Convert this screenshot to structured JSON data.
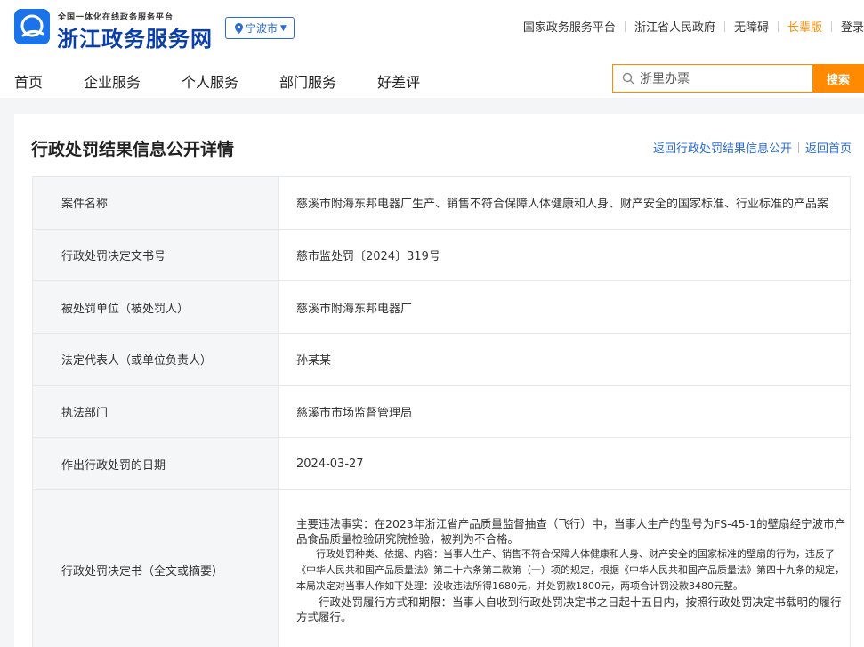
{
  "header": {
    "logo_small": "全国一体化在线政务服务平台",
    "logo_big": "浙江政务服务网",
    "city": "宁波市",
    "links": [
      "国家政务服务平台",
      "浙江省人民政府",
      "无障碍",
      "长辈版",
      "登录"
    ]
  },
  "nav": {
    "items": [
      "首页",
      "企业服务",
      "个人服务",
      "部门服务",
      "好差评"
    ],
    "search_placeholder": "浙里办票",
    "search_button": "搜索"
  },
  "page": {
    "title": "行政处罚结果信息公开详情",
    "link_back_list": "返回行政处罚结果信息公开",
    "link_home": "返回首页"
  },
  "rows": [
    {
      "label": "案件名称",
      "value": "慈溪市附海东邦电器厂生产、销售不符合保障人体健康和人身、财产安全的国家标准、行业标准的产品案"
    },
    {
      "label": "行政处罚决定文书号",
      "value": "慈市监处罚〔2024〕319号"
    },
    {
      "label": "被处罚单位（被处罚人）",
      "value": "慈溪市附海东邦电器厂"
    },
    {
      "label": "法定代表人（或单位负责人）",
      "value": "孙某某"
    },
    {
      "label": "执法部门",
      "value": "慈溪市市场监督管理局"
    },
    {
      "label": "作出行政处罚的日期",
      "value": "2024-03-27"
    }
  ],
  "decision": {
    "label": "行政处罚决定书（全文或摘要）",
    "p1": "主要违法事实：在2023年浙江省产品质量监督抽查（飞行）中，当事人生产的型号为FS-45-1的壁扇经宁波市产品食品质量检验研究院检验，被判为不合格。",
    "p2": "行政处罚种类、依据、内容：当事人生产、销售不符合保障人体健康和人身、财产安全的国家标准的壁扇的行为，违反了《中华人民共和国产品质量法》第二十六条第二款第（一）项的规定，根据《中华人民共和国产品质量法》第四十九条的规定，本局决定对当事人作如下处理：没收违法所得1680元，并处罚款1800元，两项合计罚没款3480元整。",
    "p3": "行政处罚履行方式和期限：当事人自收到行政处罚决定书之日起十五日内，按照行政处罚决定书载明的履行方式履行。"
  },
  "colors": {
    "brand_blue": "#1a73e8",
    "accent_orange": "#ff8a00",
    "link_blue": "#2a6bd6"
  }
}
